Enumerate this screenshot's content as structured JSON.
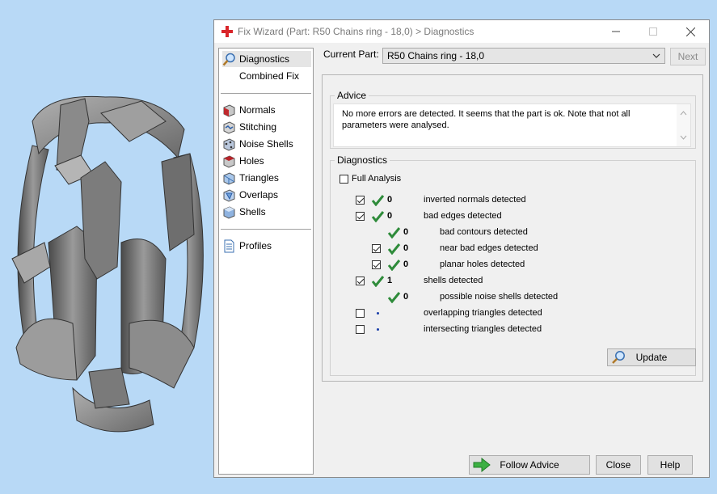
{
  "window": {
    "title": "Fix Wizard (Part: R50 Chains ring - 18,0) > Diagnostics"
  },
  "nav": {
    "items_top": [
      {
        "label": "Diagnostics",
        "icon": "magnifier-icon",
        "selected": true
      },
      {
        "label": "Combined Fix",
        "icon": "none"
      }
    ],
    "items_mid": [
      {
        "label": "Normals",
        "icon": "normals-cube-icon"
      },
      {
        "label": "Stitching",
        "icon": "stitching-icon"
      },
      {
        "label": "Noise Shells",
        "icon": "noise-shells-icon"
      },
      {
        "label": "Holes",
        "icon": "holes-cube-icon"
      },
      {
        "label": "Triangles",
        "icon": "triangles-cube-icon"
      },
      {
        "label": "Overlaps",
        "icon": "overlaps-cube-icon"
      },
      {
        "label": "Shells",
        "icon": "shells-cube-icon"
      }
    ],
    "items_bottom": [
      {
        "label": "Profiles",
        "icon": "document-icon"
      }
    ]
  },
  "part": {
    "label": "Current Part:",
    "value": "R50 Chains ring - 18,0",
    "next_label": "Next"
  },
  "advice": {
    "title": "Advice",
    "text": "No more errors are detected. It seems that the part is ok. Note that not all parameters were analysed."
  },
  "diagnostics": {
    "title": "Diagnostics",
    "full_analysis_label": "Full Analysis",
    "full_analysis_checked": false,
    "rows": [
      {
        "checkbox": true,
        "checked": true,
        "status": "ok",
        "count": "0",
        "label": "inverted normals detected",
        "indent": 0
      },
      {
        "checkbox": true,
        "checked": true,
        "status": "ok",
        "count": "0",
        "label": "bad edges detected",
        "indent": 0
      },
      {
        "checkbox": false,
        "checked": false,
        "status": "ok",
        "count": "0",
        "label": "bad contours detected",
        "indent": 1
      },
      {
        "checkbox": true,
        "checked": true,
        "status": "ok",
        "count": "0",
        "label": "near bad edges detected",
        "indent": 1
      },
      {
        "checkbox": true,
        "checked": true,
        "status": "ok",
        "count": "0",
        "label": "planar holes detected",
        "indent": 1
      },
      {
        "checkbox": true,
        "checked": true,
        "status": "ok",
        "count": "1",
        "label": "shells detected",
        "indent": 0
      },
      {
        "checkbox": false,
        "checked": false,
        "status": "ok",
        "count": "0",
        "label": "possible noise shells detected",
        "indent": 1
      },
      {
        "checkbox": true,
        "checked": false,
        "status": "none",
        "count": "",
        "label": "overlapping triangles detected",
        "indent": 0
      },
      {
        "checkbox": true,
        "checked": false,
        "status": "none",
        "count": "",
        "label": "intersecting triangles detected",
        "indent": 0
      }
    ],
    "update_label": "Update"
  },
  "footer": {
    "follow_advice_label": "Follow Advice",
    "close_label": "Close",
    "help_label": "Help"
  },
  "colors": {
    "viewport_bg": "#b8d9f6",
    "check_green": "#2e8b3a",
    "arrow_green": "#3cb043",
    "title_cross_red": "#d9252a"
  }
}
